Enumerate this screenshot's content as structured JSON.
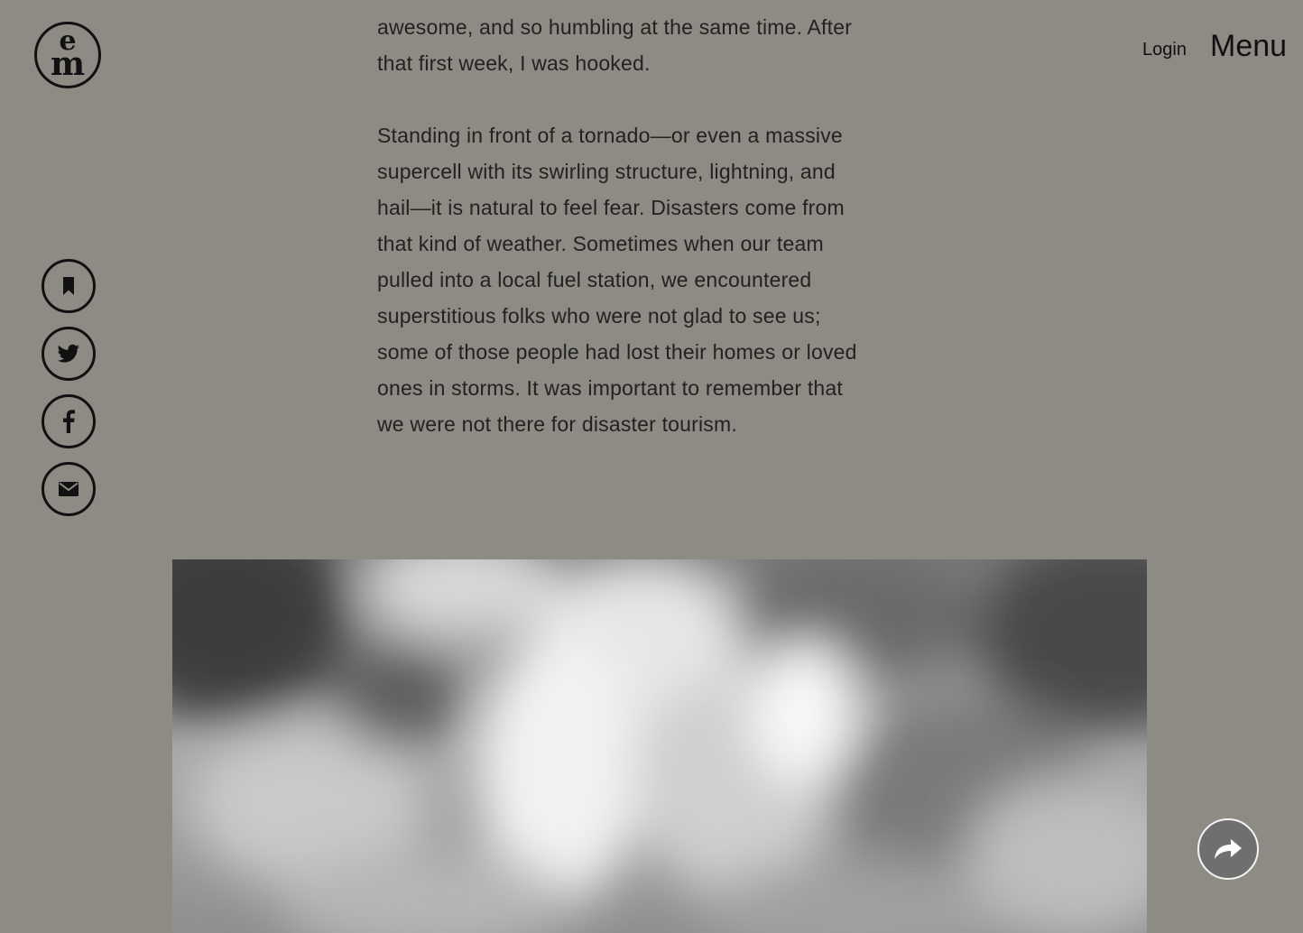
{
  "brand": {
    "logo_top": "e",
    "logo_bottom": "m"
  },
  "nav": {
    "login_label": "Login",
    "menu_label": "Menu"
  },
  "share": {
    "items": [
      {
        "icon": "bookmark-icon"
      },
      {
        "icon": "twitter-icon"
      },
      {
        "icon": "facebook-icon"
      },
      {
        "icon": "email-icon"
      }
    ]
  },
  "article": {
    "paragraph_1_lines": [
      "awesome, and so humbling at the same time. After",
      "that first week, I was hooked."
    ],
    "paragraph_2_lines": [
      "Standing in front of a tornado—or even a massive",
      "supercell with its swirling structure, lightning, and",
      "hail—it is natural to feel fear. Disasters come from",
      "that kind of weather. Sometimes when our team",
      "pulled into a local fuel station, we encountered",
      "superstitious folks who were not glad to see us;",
      "some of those people had lost their homes or loved",
      "ones in storms. It was important to remember that",
      "we were not there for disaster tourism."
    ]
  },
  "media": {
    "image": "storm-clouds-photo"
  },
  "controls": {
    "next_icon": "share-arrow-icon"
  },
  "colors": {
    "background": "#8e8b84",
    "text": "#222222",
    "ink": "#111111"
  }
}
